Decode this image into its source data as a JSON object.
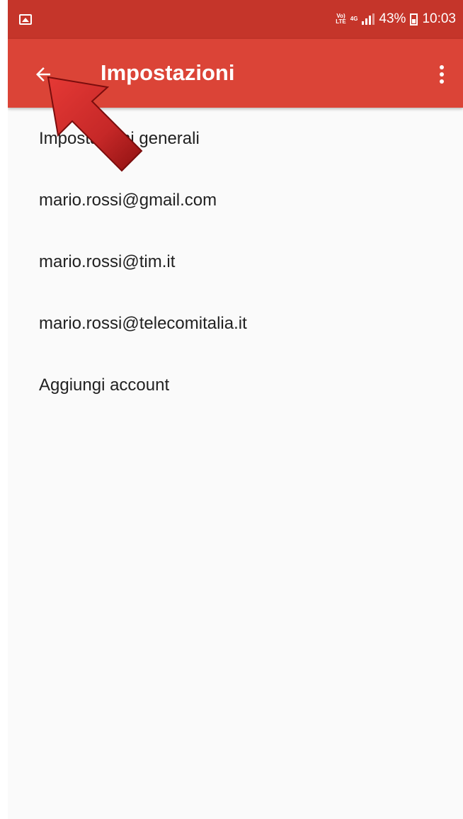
{
  "status_bar": {
    "volte": "Vo)\nLTE",
    "network": "4G",
    "battery": "43%",
    "time": "10:03",
    "icons": [
      "gallery-icon",
      "volte-icon",
      "4g-icon",
      "signal-icon",
      "battery-icon"
    ]
  },
  "toolbar": {
    "title": "Impostazioni",
    "back_icon": "arrow-left-icon",
    "more_icon": "more-vert-icon",
    "color": "#db4437"
  },
  "list": {
    "items": [
      {
        "label": "Impostazioni generali"
      },
      {
        "label": "mario.rossi@gmail.com"
      },
      {
        "label": "mario.rossi@tim.it"
      },
      {
        "label": "mario.rossi@telecomitalia.it"
      },
      {
        "label": "Aggiungi account"
      }
    ]
  },
  "annotation": {
    "arrow_color": "#c62828"
  }
}
